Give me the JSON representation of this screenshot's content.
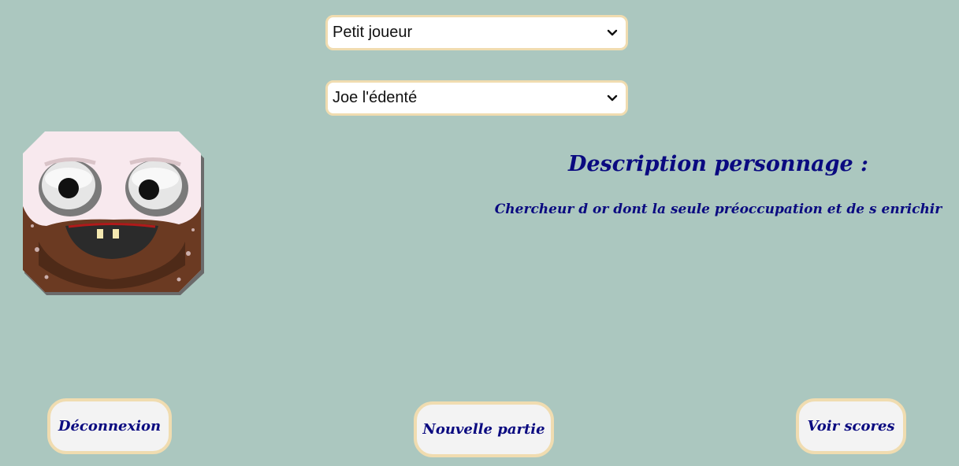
{
  "difficulty_select": {
    "selected": "Petit joueur",
    "icon": "chevron-down-icon"
  },
  "character_select": {
    "selected": "Joe l'édenté",
    "icon": "chevron-down-icon"
  },
  "character_panel": {
    "title": "Description personnage :",
    "description": "Chercheur d or dont la seule préoccupation et de s enrichir"
  },
  "actions": {
    "logout_label": "Déconnexion",
    "new_game_label": "Nouvelle partie",
    "scores_label": "Voir scores"
  },
  "colors": {
    "background": "#abc7bf",
    "accent_border": "#f0dcb0",
    "text_navy": "#0a0a80",
    "button_fill": "#f3f3f3"
  }
}
